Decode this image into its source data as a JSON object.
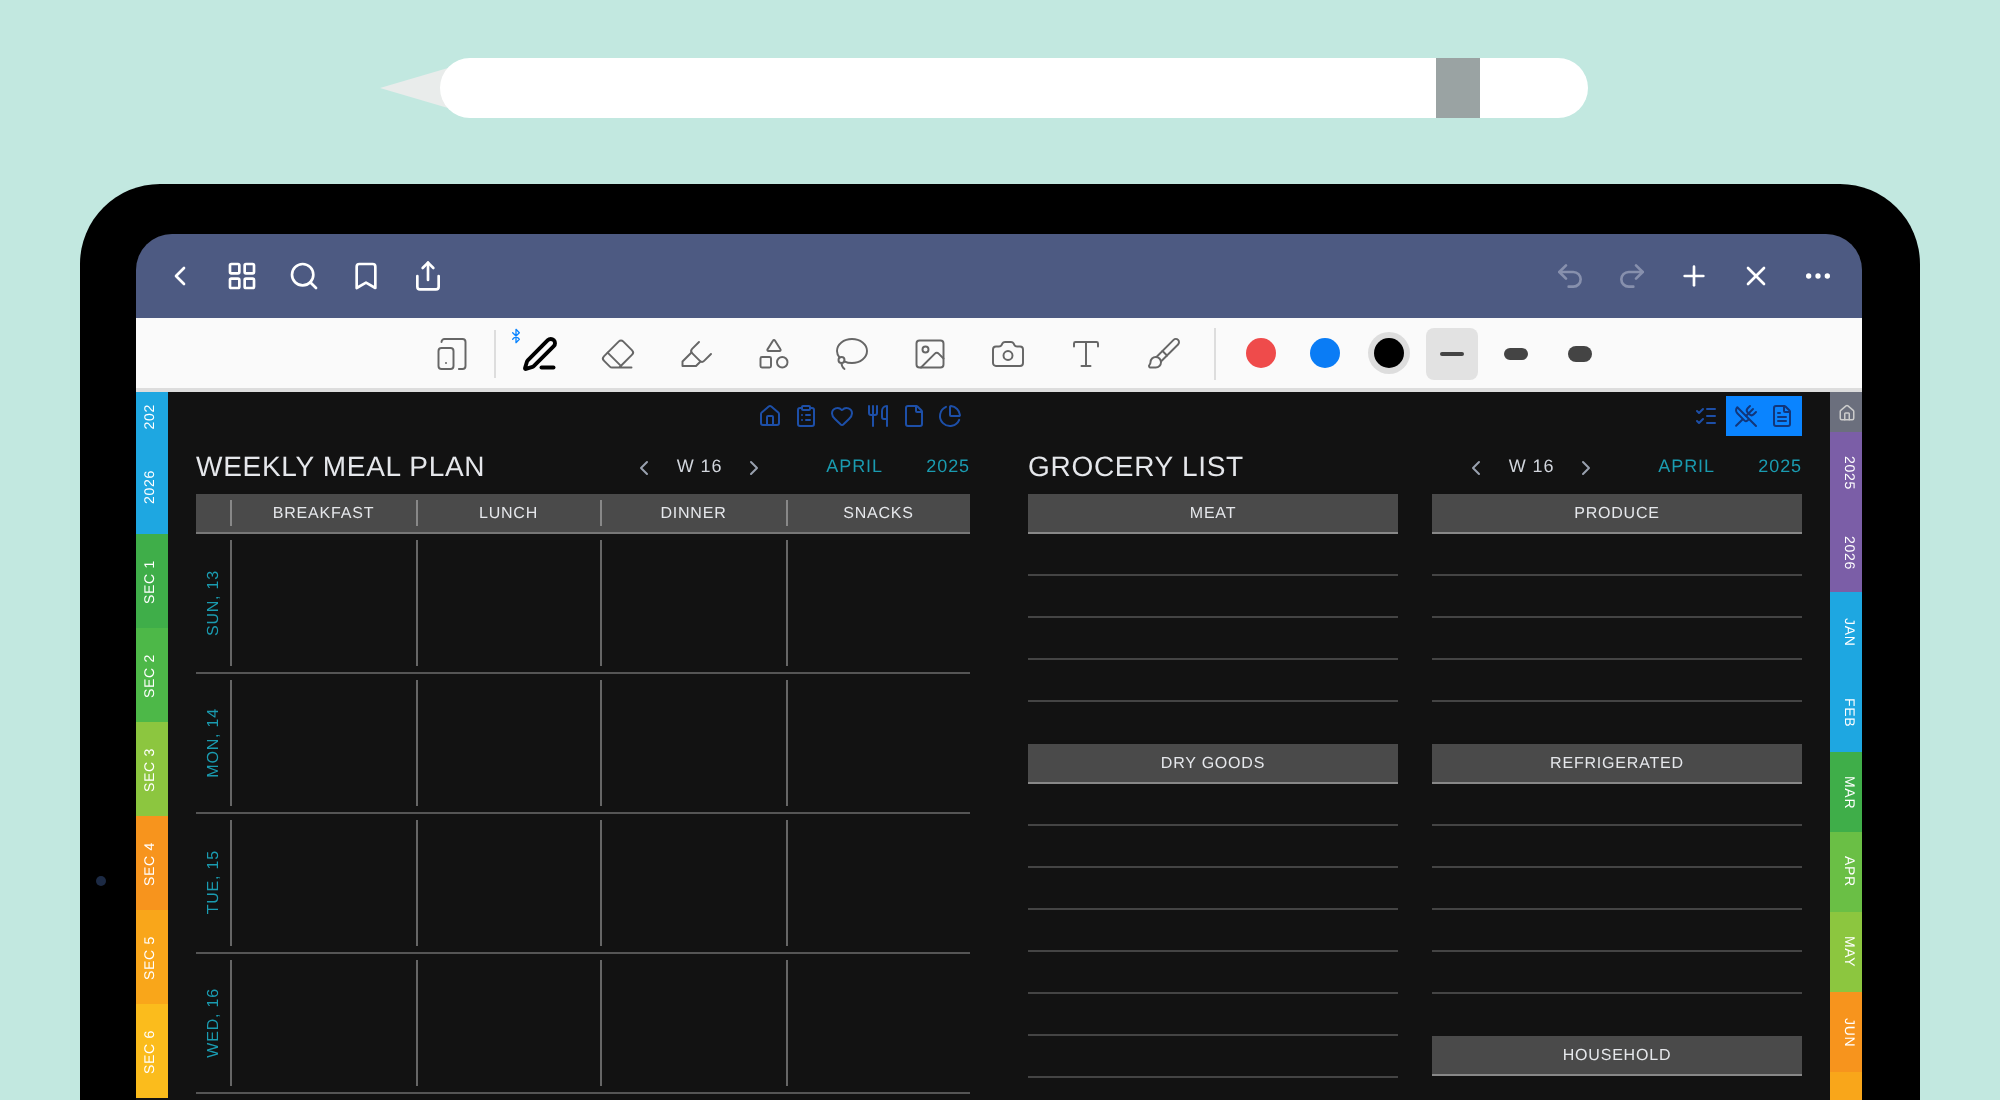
{
  "top_bar": {
    "history_buttons": [
      {
        "kind": "undo",
        "disabled": true
      },
      {
        "kind": "redo",
        "disabled": true
      }
    ]
  },
  "toolbar": {
    "tools": [
      {
        "kind": "reader",
        "selected": false
      },
      {
        "kind": "pen",
        "selected": true
      },
      {
        "kind": "eraser",
        "selected": false
      },
      {
        "kind": "highlighter",
        "selected": false
      },
      {
        "kind": "shapes",
        "selected": false
      },
      {
        "kind": "lasso",
        "selected": false
      },
      {
        "kind": "image",
        "selected": false
      },
      {
        "kind": "camera",
        "selected": false
      },
      {
        "kind": "text",
        "selected": false
      },
      {
        "kind": "brush",
        "selected": false
      }
    ],
    "colors": [
      {
        "color": "#ef4b4b",
        "selected": false
      },
      {
        "color": "#0a7cf5",
        "selected": false
      },
      {
        "color": "#000000",
        "selected": true
      }
    ],
    "stroke_widths": [
      {
        "selected": true
      },
      {
        "selected": false
      },
      {
        "selected": false
      }
    ]
  },
  "left_tabs": [
    {
      "label": "202",
      "color": "#1ea7e1"
    },
    {
      "label": "2026",
      "color": "#1ea7e1"
    },
    {
      "label": "SEC 1",
      "color": "#3fae49"
    },
    {
      "label": "SEC 2",
      "color": "#4db848"
    },
    {
      "label": "SEC 3",
      "color": "#8cc63f"
    },
    {
      "label": "SEC 4",
      "color": "#f7941d"
    },
    {
      "label": "SEC 5",
      "color": "#f9a61a"
    },
    {
      "label": "SEC 6",
      "color": "#fbbc1c"
    }
  ],
  "right_tabs": [
    {
      "label": "2025",
      "color": "#7b5ea7"
    },
    {
      "label": "2026",
      "color": "#7b5ea7"
    },
    {
      "label": "JAN",
      "color": "#1ea7e1"
    },
    {
      "label": "FEB",
      "color": "#1ea7e1"
    },
    {
      "label": "MAR",
      "color": "#3fae49"
    },
    {
      "label": "APR",
      "color": "#6abf45"
    },
    {
      "label": "MAY",
      "color": "#8cc63f"
    },
    {
      "label": "JUN",
      "color": "#f7941d"
    }
  ],
  "meal_plan": {
    "title": "WEEKLY MEAL PLAN",
    "week": "W 16",
    "month": "APRIL",
    "year": "2025",
    "columns": [
      "BREAKFAST",
      "LUNCH",
      "DINNER",
      "SNACKS"
    ],
    "days": [
      "SUN, 13",
      "MON, 14",
      "TUE, 15",
      "WED, 16"
    ]
  },
  "grocery_list": {
    "title": "GROCERY LIST",
    "week": "W 16",
    "month": "APRIL",
    "year": "2025",
    "columns": [
      [
        "MEAT",
        "DRY GOODS"
      ],
      [
        "PRODUCE",
        "REFRIGERATED",
        "HOUSEHOLD"
      ]
    ]
  }
}
